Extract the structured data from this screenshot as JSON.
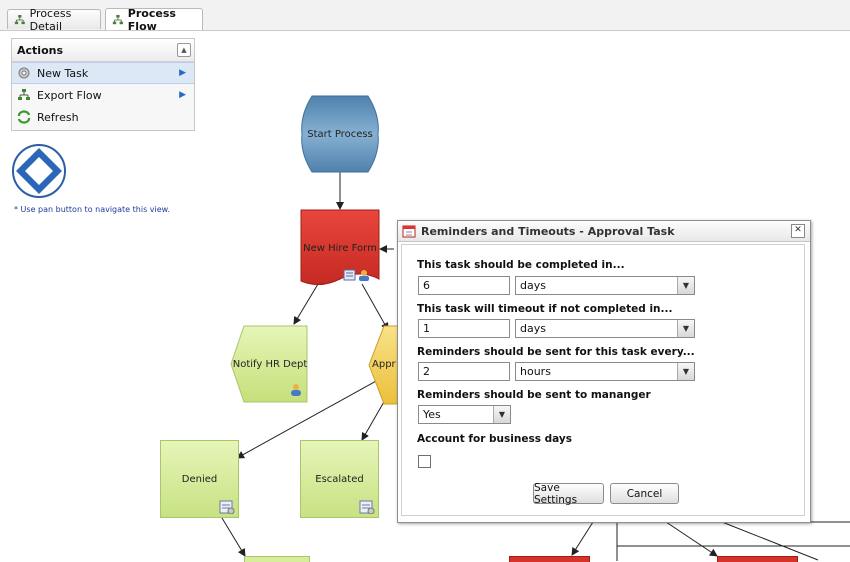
{
  "tabs": [
    {
      "label": "Process Detail",
      "icon": "flow-icon",
      "active": false
    },
    {
      "label": "Process Flow",
      "icon": "flow-icon",
      "active": true
    }
  ],
  "actions": {
    "title": "Actions",
    "items": [
      {
        "label": "New Task",
        "icon": "gear-icon"
      },
      {
        "label": "Export Flow",
        "icon": "flow-icon"
      },
      {
        "label": "Refresh",
        "icon": "refresh-icon"
      }
    ]
  },
  "pan_hint": "* Use pan button to navigate this view.",
  "flow": {
    "start": "Start Process",
    "new_hire": "New Hire Form",
    "notify_hr": "Notify HR Dept",
    "approval_partial": "Appr",
    "denied": "Denied",
    "escalated": "Escalated"
  },
  "dialog": {
    "title": "Reminders and Timeouts - Approval Task",
    "complete_label": "This task should be completed in...",
    "complete_value": "6",
    "complete_unit": "days",
    "timeout_label": "This task will timeout if not completed in...",
    "timeout_value": "1",
    "timeout_unit": "days",
    "reminder_label": "Reminders should be sent for this task every...",
    "reminder_value": "2",
    "reminder_unit": "hours",
    "manager_label": "Reminders should be sent to mananger",
    "manager_value": "Yes",
    "business_label": "Account for business days",
    "business_checked": false,
    "save_label": "Save Settings",
    "cancel_label": "Cancel"
  },
  "colors": {
    "start_node": "#6e9ec4",
    "new_hire_node": "#d8332a",
    "task_green": "#d6ed9a",
    "approval_yellow": "#f4d25a"
  }
}
